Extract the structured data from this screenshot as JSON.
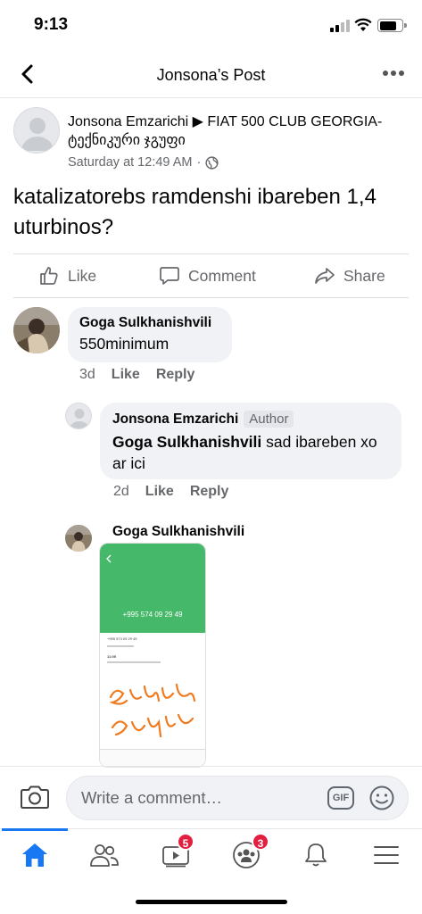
{
  "status_bar": {
    "time": "9:13"
  },
  "header": {
    "title": "Jonsona’s Post"
  },
  "post": {
    "author_line": "Jonsona Emzarichi ▶ FIAT 500 CLUB GEORGIA-ტექნიკური ჯგუფი",
    "timestamp": "Saturday at 12:49 AM",
    "separator": "·",
    "text": "katalizatorebs ramdenshi ibareben 1,4 uturbinos?"
  },
  "actions": {
    "like": "Like",
    "comment": "Comment",
    "share": "Share"
  },
  "comments": [
    {
      "name": "Goga Sulkhanishvili",
      "text": "550minimum",
      "age": "3d",
      "like": "Like",
      "reply": "Reply"
    }
  ],
  "replies": [
    {
      "name": "Jonsona Emzarichi",
      "badge": "Author",
      "mention": "Goga Sulkhanishvili",
      "text": " sad ibareben xo ar ici",
      "age": "2d",
      "like": "Like",
      "reply": "Reply"
    },
    {
      "name": "Goga Sulkhanishvili"
    }
  ],
  "attachment": {
    "phone_number": "+995 574 09 29 49",
    "detail_number": "+995 574 09 29 49",
    "time": "11:05"
  },
  "composer": {
    "placeholder": "Write a comment…",
    "gif": "GIF"
  },
  "tabbar": {
    "badges": {
      "watch": "5",
      "groups": "3"
    }
  },
  "colors": {
    "accent": "#1877f2",
    "badge": "#e41e3f",
    "bubble": "#f0f2f5",
    "handwriting": "#f07a1e"
  }
}
